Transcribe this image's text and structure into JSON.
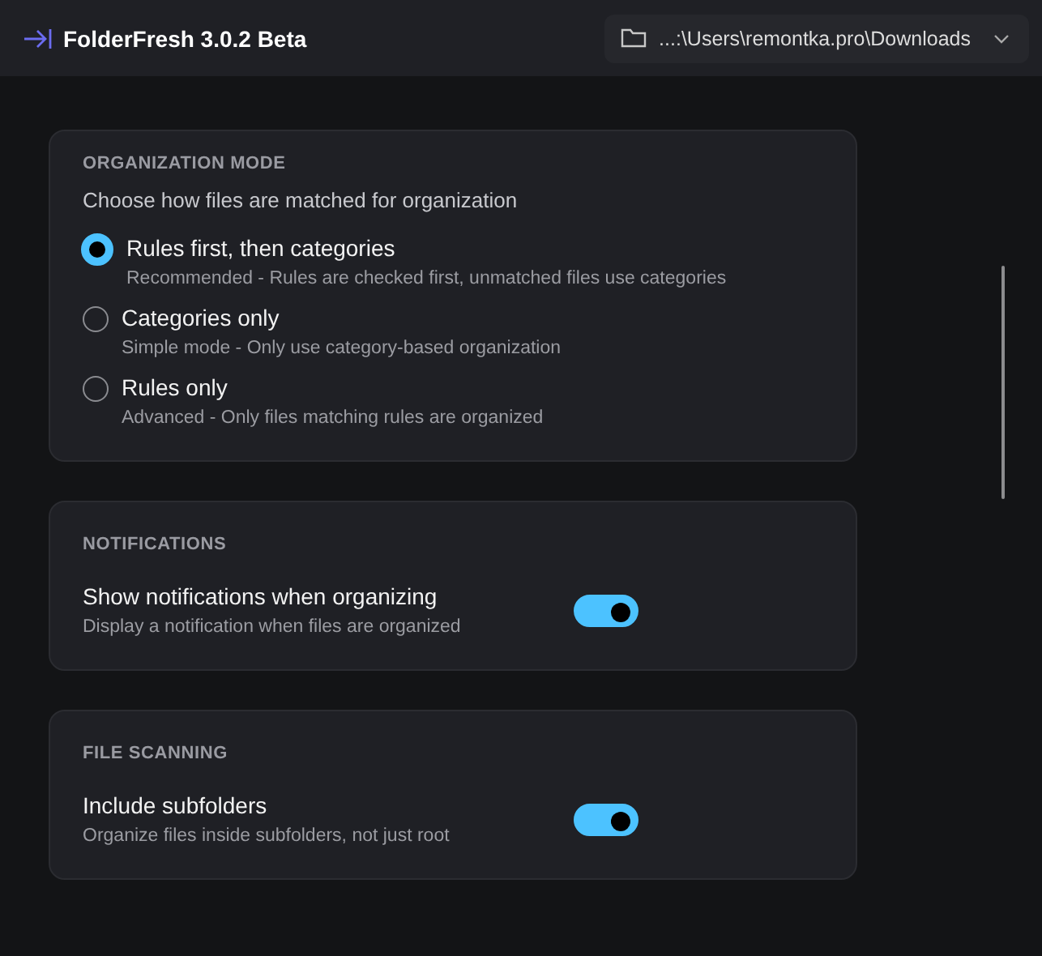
{
  "app": {
    "title": "FolderFresh 3.0.2 Beta"
  },
  "folder_picker": {
    "path": "...:\\Users\\remontka.pro\\Downloads"
  },
  "organization_mode": {
    "heading": "ORGANIZATION MODE",
    "description": "Choose how files are matched for organization",
    "options": [
      {
        "label": "Rules first, then categories",
        "description": "Recommended - Rules are checked first, unmatched files use categories",
        "selected": true
      },
      {
        "label": "Categories only",
        "description": "Simple mode - Only use category-based organization",
        "selected": false
      },
      {
        "label": "Rules only",
        "description": "Advanced - Only files matching rules are organized",
        "selected": false
      }
    ]
  },
  "sections": [
    {
      "heading": "NOTIFICATIONS",
      "settings": [
        {
          "label": "Show notifications when organizing",
          "description": "Display a notification when files are organized",
          "on": true
        }
      ]
    },
    {
      "heading": "FILE SCANNING",
      "settings": [
        {
          "label": "Include subfolders",
          "description": "Organize files inside subfolders, not just root",
          "on": true
        }
      ]
    }
  ]
}
